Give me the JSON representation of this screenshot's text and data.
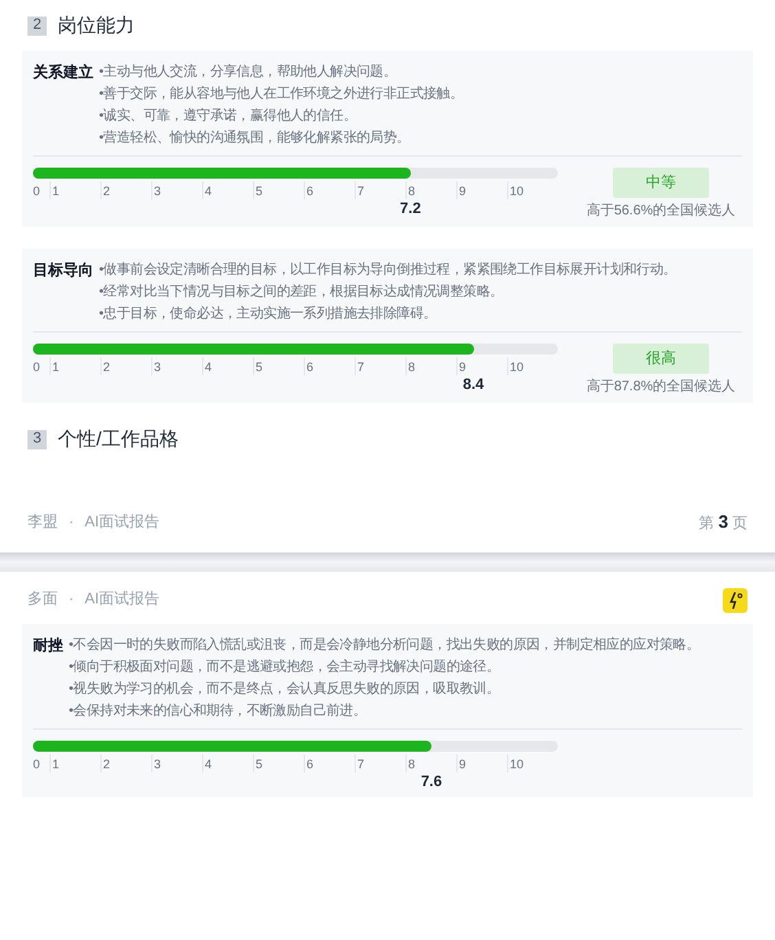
{
  "sections_top": [
    {
      "number": "2",
      "title": "岗位能力"
    }
  ],
  "cards": [
    {
      "label": "关系建立",
      "bullets": [
        "•主动与他人交流，分享信息，帮助他人解决问题。",
        "•善于交际，能从容地与他人在工作环境之外进行非正式接触。",
        "•诚实、可靠，遵守承诺，赢得他人的信任。",
        "•营造轻松、愉快的沟通氛围，能够化解紧张的局势。"
      ],
      "level": 0.72,
      "reading": "7.2",
      "ticks": [
        "0",
        "1",
        "2",
        "3",
        "4",
        "5",
        "6",
        "7",
        "8",
        "9",
        "10"
      ],
      "rating": "中等",
      "percentile": "高于56.6%的全国候选人"
    },
    {
      "label": "目标导向",
      "bullets": [
        "•做事前会设定清晰合理的目标，以工作目标为导向倒推过程，紧紧围绕工作目标展开计划和行动。",
        "•经常对比当下情况与目标之间的差距，根据目标达成情况调整策略。",
        "•忠于目标，使命必达，主动实施一系列措施去排除障碍。"
      ],
      "level": 0.84,
      "reading": "8.4",
      "ticks": [
        "0",
        "1",
        "2",
        "3",
        "4",
        "5",
        "6",
        "7",
        "8",
        "9",
        "10"
      ],
      "rating": "很高",
      "percentile": "高于87.8%的全国候选人"
    }
  ],
  "section_next": {
    "number": "3",
    "title": "个性/工作品格"
  },
  "footer": {
    "author": "李盟",
    "separator": "·",
    "report": "AI面试报告",
    "page": "第 **3** 页"
  },
  "next_page": {
    "header": {
      "brand": "多面",
      "separator": "·",
      "report": "AI面试报告"
    },
    "card": {
      "label": "耐挫",
      "bullets": [
        "•不会因一时的失败而陷入慌乱或沮丧，而是会冷静地分析问题，找出失败的原因，并制定相应的应对策略。",
        "•倾向于积极面对问题，而不是逃避或抱怨，会主动寻找解决问题的途径。",
        "•视失败为学习的机会，而不是终点，会认真反思失败的原因，吸取教训。",
        "•会保持对未来的信心和期待，不断激励自己前进。"
      ],
      "level": 0.76,
      "reading": "7.6",
      "ticks": [
        "0",
        "1",
        "2",
        "3",
        "4",
        "5",
        "6",
        "7",
        "8",
        "9",
        "10"
      ]
    }
  }
}
